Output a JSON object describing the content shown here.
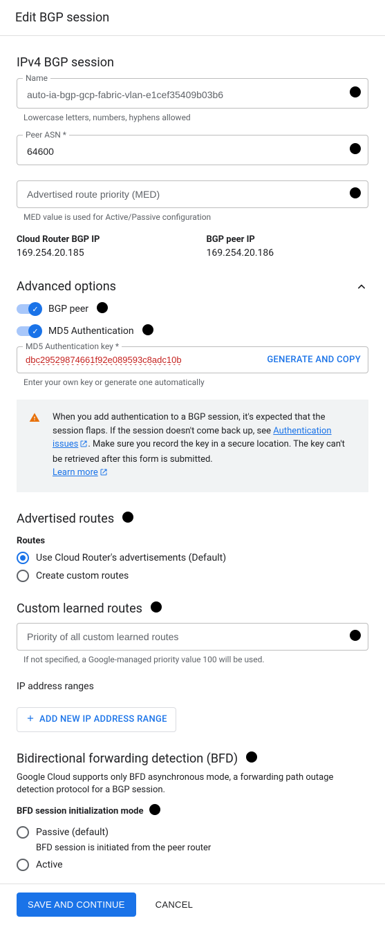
{
  "header": {
    "title": "Edit BGP session"
  },
  "ipv4": {
    "title": "IPv4 BGP session",
    "name": {
      "label": "Name",
      "value": "auto-ia-bgp-gcp-fabric-vlan-e1cef35409b03b6",
      "hint": "Lowercase letters, numbers, hyphens allowed"
    },
    "peer_asn": {
      "label": "Peer ASN *",
      "value": "64600"
    },
    "med": {
      "placeholder": "Advertised route priority (MED)",
      "hint": "MED value is used for Active/Passive configuration"
    },
    "cloud_router": {
      "label": "Cloud Router BGP IP",
      "value": "169.254.20.185"
    },
    "bgp_peer": {
      "label": "BGP peer IP",
      "value": "169.254.20.186"
    }
  },
  "advanced": {
    "title": "Advanced options",
    "bgp_peer_label": "BGP peer",
    "md5_auth_label": "MD5 Authentication",
    "md5_key": {
      "label": "MD5 Authentication key *",
      "value": "dbc29529874661f92e089593c8adc10b",
      "gen_label": "GENERATE AND COPY",
      "hint": "Enter your own key or generate one automatically"
    },
    "warning": {
      "p1": "When you add authentication to a BGP session, it's expected that the session flaps. If the session doesn't come back up, see ",
      "link1": "Authentication issues",
      "p2": ". Make sure you record the key in a secure location. The key can't be retrieved after this form is submitted. ",
      "link2": "Learn more"
    }
  },
  "advertised": {
    "title": "Advertised routes",
    "routes_label": "Routes",
    "opt_default": "Use Cloud Router's advertisements (Default)",
    "opt_custom": "Create custom routes"
  },
  "custom_learned": {
    "title": "Custom learned routes",
    "priority_placeholder": "Priority of all custom learned routes",
    "priority_hint": "If not specified, a Google-managed priority value 100 will be used."
  },
  "ip_ranges": {
    "title": "IP address ranges",
    "add_label": "ADD NEW IP ADDRESS RANGE"
  },
  "bfd": {
    "title": "Bidirectional forwarding detection (BFD)",
    "desc": "Google Cloud supports only BFD asynchronous mode, a forwarding path outage detection protocol for a BGP session.",
    "mode_label": "BFD session initialization mode",
    "opt_passive": "Passive (default)",
    "opt_passive_sub": "BFD session is initiated from the peer router",
    "opt_active": "Active"
  },
  "footer": {
    "save": "SAVE AND CONTINUE",
    "cancel": "CANCEL"
  }
}
